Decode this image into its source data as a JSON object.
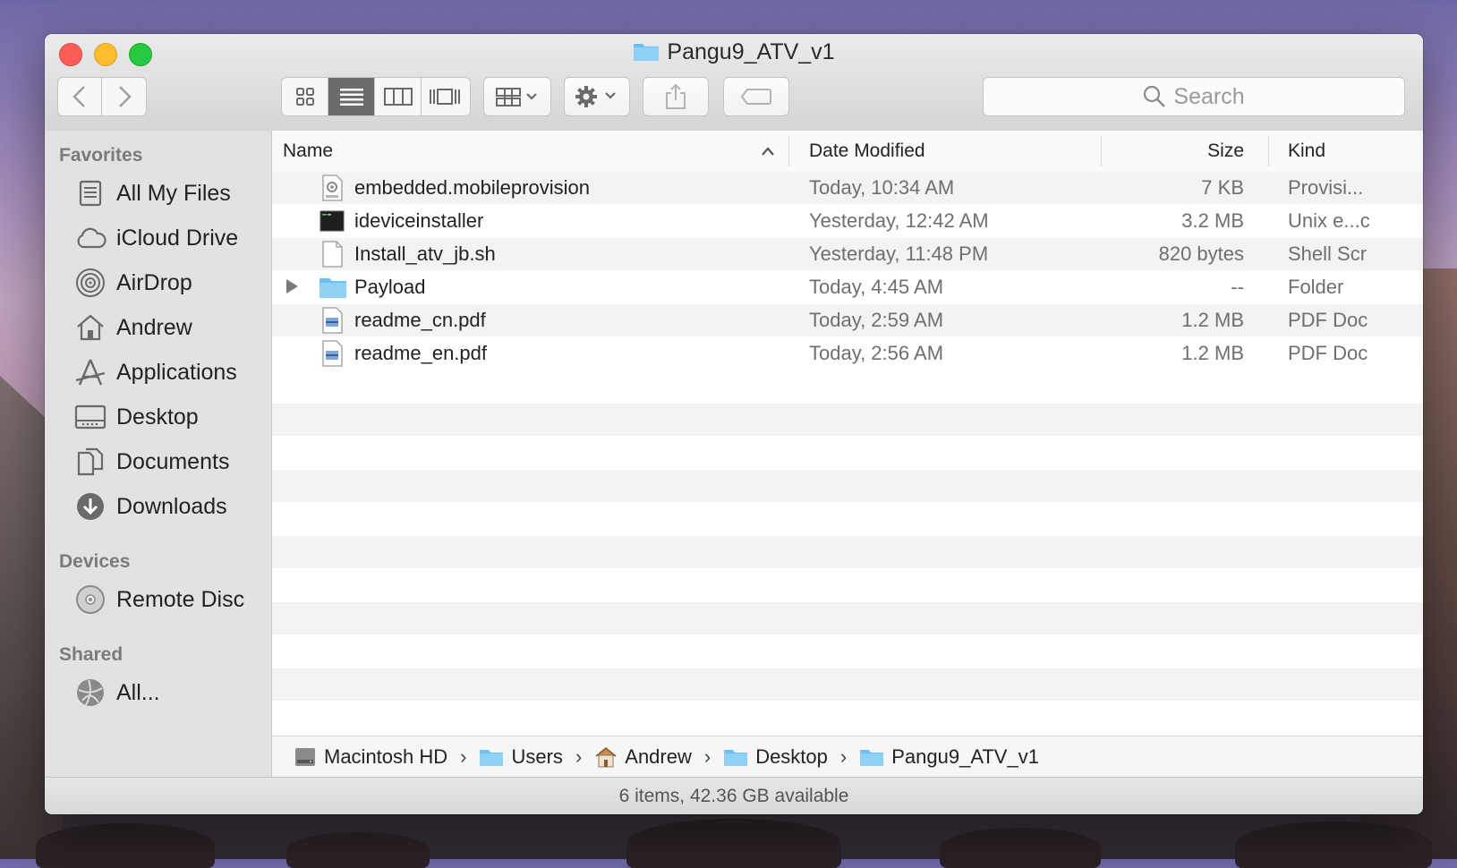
{
  "window": {
    "title": "Pangu9_ATV_v1"
  },
  "toolbar": {
    "search_placeholder": "Search"
  },
  "sidebar": {
    "favorites_label": "Favorites",
    "favorites": [
      {
        "label": "All My Files",
        "icon": "all-files-icon"
      },
      {
        "label": "iCloud Drive",
        "icon": "cloud-icon"
      },
      {
        "label": "AirDrop",
        "icon": "airdrop-icon"
      },
      {
        "label": "Andrew",
        "icon": "home-icon"
      },
      {
        "label": "Applications",
        "icon": "applications-icon"
      },
      {
        "label": "Desktop",
        "icon": "desktop-icon"
      },
      {
        "label": "Documents",
        "icon": "documents-icon"
      },
      {
        "label": "Downloads",
        "icon": "downloads-icon"
      }
    ],
    "devices_label": "Devices",
    "devices": [
      {
        "label": "Remote Disc",
        "icon": "disc-icon"
      }
    ],
    "shared_label": "Shared",
    "shared": [
      {
        "label": "All...",
        "icon": "network-icon"
      }
    ]
  },
  "columns": {
    "name": "Name",
    "date": "Date Modified",
    "size": "Size",
    "kind": "Kind"
  },
  "files": [
    {
      "name": "embedded.mobileprovision",
      "date": "Today, 10:34 AM",
      "size": "7 KB",
      "kind": "Provisi...",
      "icon": "provision-file-icon"
    },
    {
      "name": "ideviceinstaller",
      "date": "Yesterday, 12:42 AM",
      "size": "3.2 MB",
      "kind": "Unix e...c",
      "icon": "terminal-exec-icon"
    },
    {
      "name": "Install_atv_jb.sh",
      "date": "Yesterday, 11:48 PM",
      "size": "820 bytes",
      "kind": "Shell Scr",
      "icon": "blank-file-icon"
    },
    {
      "name": "Payload",
      "date": "Today, 4:45 AM",
      "size": "--",
      "kind": "Folder",
      "icon": "folder-icon"
    },
    {
      "name": "readme_cn.pdf",
      "date": "Today, 2:59 AM",
      "size": "1.2 MB",
      "kind": "PDF Doc",
      "icon": "pdf-file-icon"
    },
    {
      "name": "readme_en.pdf",
      "date": "Today, 2:56 AM",
      "size": "1.2 MB",
      "kind": "PDF Doc",
      "icon": "pdf-file-icon"
    }
  ],
  "path": [
    {
      "label": "Macintosh HD",
      "icon": "hard-drive-icon"
    },
    {
      "label": "Users",
      "icon": "folder-icon"
    },
    {
      "label": "Andrew",
      "icon": "home-icon"
    },
    {
      "label": "Desktop",
      "icon": "folder-icon"
    },
    {
      "label": "Pangu9_ATV_v1",
      "icon": "folder-icon"
    }
  ],
  "path_separator": "›",
  "status": "6 items, 42.36 GB available",
  "colors": {
    "folder_blue": "#6cc1f2",
    "close": "#fd5f57",
    "minimize": "#fdbc2e",
    "zoom": "#28c840"
  }
}
